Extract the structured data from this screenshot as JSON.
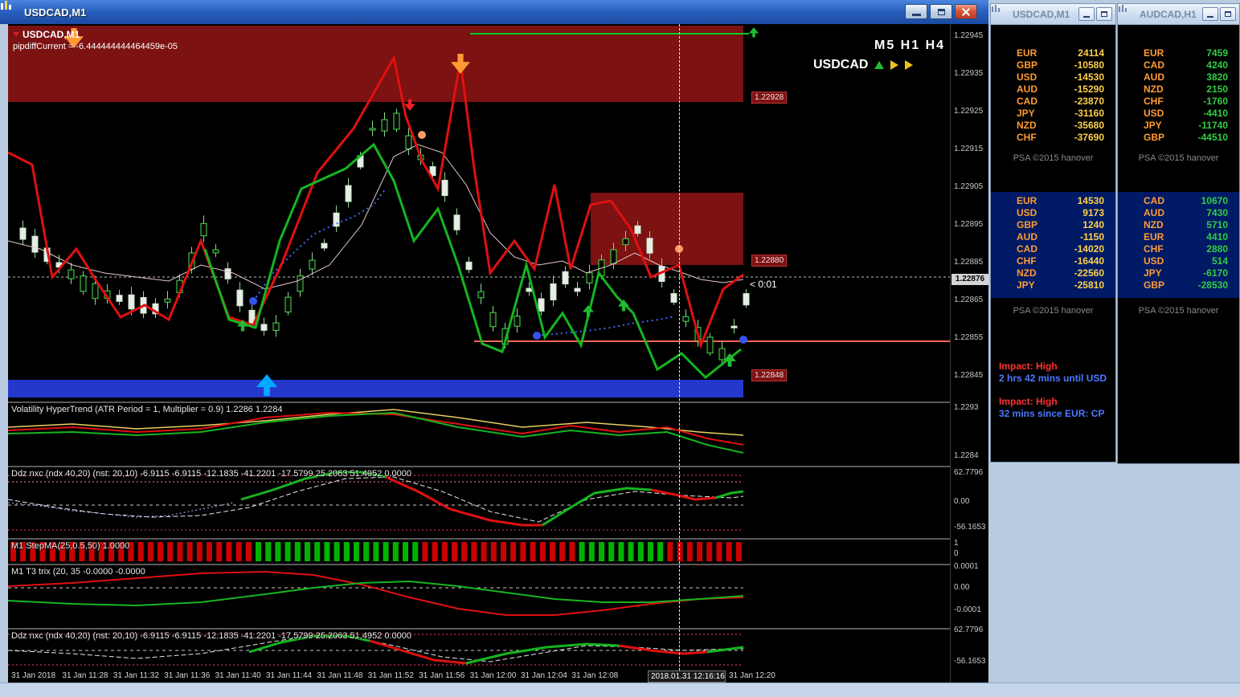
{
  "window": {
    "title": "USDCAD,M1"
  },
  "chart": {
    "symbol_label": "USDCAD,M1",
    "pipdiff_label": "pipdiffCurrent = -6.444444444464459e-05",
    "timeframes": "M5 H1 H4",
    "watermark": "USDCAD",
    "signal_arrows": [
      "up-arrow-green",
      "right-arrow-yellow",
      "right-arrow-yellow"
    ],
    "countdown": "< 0:01",
    "current_price": "1.22876",
    "price_ticks": [
      "1.22945",
      "1.22935",
      "1.22925",
      "1.22915",
      "1.22905",
      "1.22895",
      "1.22885",
      "1.22865",
      "1.22855",
      "1.22845"
    ],
    "level_labels": [
      "1.22928",
      "1.22880",
      "1.22848"
    ]
  },
  "panes": {
    "hypertrend": {
      "label": "Volatility HyperTrend (ATR Period = 1, Multiplier = 0.9) 1.2286 1.2284",
      "ticks": [
        "1.2293",
        "1.2284"
      ]
    },
    "ddz_top": {
      "label": "Ddz nxc (ndx 40,20) (nst: 20,10) -6.9115 -6.9115 -12.1835 -41.2201 -17.5799 25.2063 51.4952 0.0000",
      "ticks": [
        "62.7796",
        "0.00",
        "-56.1653"
      ]
    },
    "stepma": {
      "label": "M1 StepMA(25,0.5,50) 1.0000",
      "ticks": [
        "1",
        "0"
      ],
      "bars": "RRRRRRRRRRRRRRRRRRRRRRRRRGGGGGGGGGGGGGGGGGRRRRRRRRRRRRRRRRGGGGGGGGGRRRRRRRR"
    },
    "trix": {
      "label": "M1 T3 trix (20, 35 -0.0000 -0.0000",
      "ticks": [
        "0.0001",
        "0.00",
        "-0.0001"
      ]
    },
    "ddz_bottom": {
      "label": "Ddz nxc (ndx 40,20) (nst: 20,10) -6.9115 -6.9115 -12.1835 -41.2201 -17.5799 25.2063 51.4952 0.0000",
      "ticks": [
        "62.7796",
        "-56.1653"
      ]
    }
  },
  "time_axis": {
    "labels": [
      "31 Jan 2018",
      "31 Jan 11:28",
      "31 Jan 11:32",
      "31 Jan 11:36",
      "31 Jan 11:40",
      "31 Jan 11:44",
      "31 Jan 11:48",
      "31 Jan 11:52",
      "31 Jan 11:56",
      "31 Jan 12:00",
      "31 Jan 12:04",
      "31 Jan 12:08"
    ],
    "crosshair_label": "2018.01.31 12:16:16",
    "last_label": "31 Jan 12:20"
  },
  "panel_usdcad": {
    "title": "USDCAD,M1",
    "strength_fast": [
      [
        "EUR",
        "24114"
      ],
      [
        "GBP",
        "-10580"
      ],
      [
        "USD",
        "-14530"
      ],
      [
        "AUD",
        "-15290"
      ],
      [
        "CAD",
        "-23870"
      ],
      [
        "JPY",
        "-31160"
      ],
      [
        "NZD",
        "-35680"
      ],
      [
        "CHF",
        "-37690"
      ]
    ],
    "copyright1": "PSA ©2015 hanover",
    "strength_slow": [
      [
        "EUR",
        "14530"
      ],
      [
        "USD",
        "9173"
      ],
      [
        "GBP",
        "1240"
      ],
      [
        "AUD",
        "-1150"
      ],
      [
        "CAD",
        "-14020"
      ],
      [
        "CHF",
        "-16440"
      ],
      [
        "NZD",
        "-22560"
      ],
      [
        "JPY",
        "-25810"
      ]
    ],
    "copyright2": "PSA ©2015 hanover",
    "news": [
      {
        "impact": "Impact: High",
        "detail": "2 hrs 42 mins until USD"
      },
      {
        "impact": "Impact: High",
        "detail": "32 mins since EUR: CP"
      }
    ]
  },
  "panel_audcad": {
    "title": "AUDCAD,H1",
    "strength_fast": [
      [
        "EUR",
        "7459"
      ],
      [
        "CAD",
        "4240"
      ],
      [
        "AUD",
        "3820"
      ],
      [
        "NZD",
        "2150"
      ],
      [
        "CHF",
        "-1760"
      ],
      [
        "USD",
        "-4410"
      ],
      [
        "JPY",
        "-11740"
      ],
      [
        "GBP",
        "-44510"
      ]
    ],
    "copyright1": "PSA ©2015 hanover",
    "strength_slow": [
      [
        "CAD",
        "10670"
      ],
      [
        "AUD",
        "7430"
      ],
      [
        "NZD",
        "5710"
      ],
      [
        "EUR",
        "4410"
      ],
      [
        "CHF",
        "2880"
      ],
      [
        "USD",
        "514"
      ],
      [
        "JPY",
        "-6170"
      ],
      [
        "GBP",
        "-28530"
      ]
    ],
    "copyright2": "PSA ©2015 hanover"
  },
  "colors": {
    "zone_red": "#7c1212",
    "band_blue": "#2438cc",
    "bull_green": "#4ade4a",
    "value_yellow": "#ffd24a",
    "value_green": "#33cc44",
    "label_orange": "#ff9c33",
    "news_red": "#ff3333",
    "news_blue": "#4d79ff"
  }
}
